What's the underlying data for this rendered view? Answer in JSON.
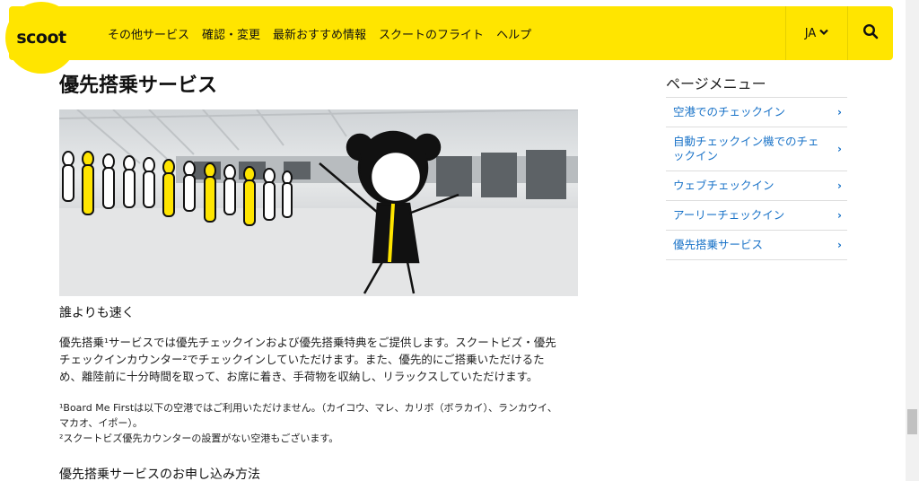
{
  "header": {
    "logo": "scoot",
    "nav": [
      "その他サービス",
      "確認・変更",
      "最新おすすめ情報",
      "スクートのフライト",
      "ヘルプ"
    ],
    "lang": "JA",
    "icons": {
      "lang": "chevron-down-icon",
      "search": "search-icon"
    },
    "accent": "#ffe500"
  },
  "main": {
    "title": "優先搭乗サービス",
    "subhead": "誰よりも速く",
    "para_l1": "優先搭乗¹サービスでは優先チェックインおよび優先搭乗特典をご提供します。スクートビズ・優先",
    "para_l2": "チェックインカウンター²でチェックインしていただけます。また、優先的にご搭乗いただけるた",
    "para_l3": "め、離陸前に十分時間を取って、お席に着き、手荷物を収納し、リラックスしていただけます。",
    "note_l1": "¹Board Me Firstは以下の空港ではご利用いただけません。（カイコウ、マレ、カリボ（ボラカイ）、ランカウイ、",
    "note_l2": "マカオ、イポー）。",
    "note_l3": "²スクートビズ優先カウンターの設置がない空港もございます。",
    "section_title": "優先搭乗サービスのお申し込み方法"
  },
  "sidebar": {
    "title": "ページメニュー",
    "items": [
      {
        "label": "空港でのチェックイン"
      },
      {
        "label": "自動チェックイン機でのチェックイン"
      },
      {
        "label": "ウェブチェックイン"
      },
      {
        "label": "アーリーチェックイン"
      },
      {
        "label": "優先搭乗サービス"
      }
    ],
    "link_color": "#1a73c8",
    "arrow_icon": "chevron-right-icon"
  }
}
